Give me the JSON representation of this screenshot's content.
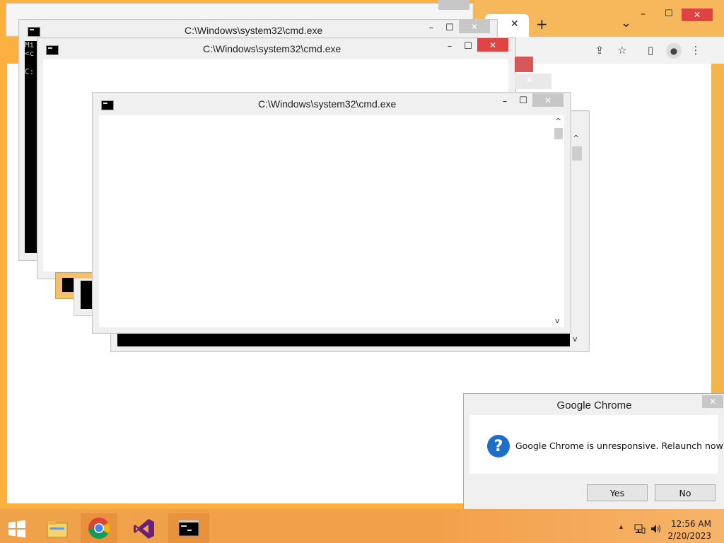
{
  "windows": {
    "cmd_title": "C:\\Windows\\system32\\cmd.exe",
    "cmd_back_text_1": "Mi",
    "cmd_back_text_2": "<c",
    "cmd_back_text_3": "C:",
    "minimize_glyph": "–",
    "maximize_glyph": "☐",
    "close_glyph": "✕"
  },
  "chrome": {
    "new_tab_glyph": "+",
    "tab_close_glyph": "✕",
    "dropdown_glyph": "⌄",
    "share_glyph": "⇪",
    "star_glyph": "☆",
    "sidepanel_glyph": "▯",
    "profile_glyph": "●",
    "menu_glyph": "⋮"
  },
  "dialog": {
    "title": "Google Chrome",
    "message": "Google Chrome is unresponsive. Relaunch now?",
    "icon_glyph": "?",
    "yes_label": "Yes",
    "no_label": "No"
  },
  "taskbar": {
    "time": "12:56 AM",
    "date": "2/20/2023",
    "tray_arrow": "▴"
  },
  "colors": {
    "accent": "#fbb040",
    "close_red": "#e04343",
    "question_blue": "#1e6fc7"
  }
}
